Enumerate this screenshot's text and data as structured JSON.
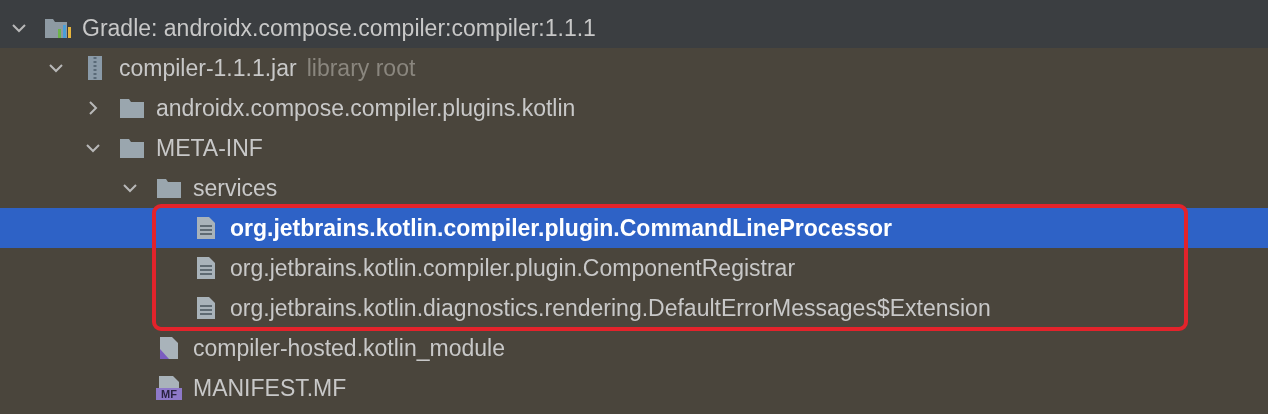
{
  "tree": [
    {
      "kind": "library",
      "label": "Gradle: androidx.compose.compiler:compiler:1.1.1",
      "expanded": true,
      "selected": false,
      "children": [
        {
          "kind": "jar",
          "label": "compiler-1.1.1.jar",
          "hint": "library root",
          "expanded": true,
          "selected": false,
          "children": [
            {
              "kind": "folder",
              "label": "androidx.compose.compiler.plugins.kotlin",
              "expanded": false,
              "selected": false
            },
            {
              "kind": "folder",
              "label": "META-INF",
              "expanded": true,
              "selected": false,
              "children": [
                {
                  "kind": "folder",
                  "label": "services",
                  "expanded": true,
                  "selected": false,
                  "children": [
                    {
                      "kind": "file",
                      "label": "org.jetbrains.kotlin.compiler.plugin.CommandLineProcessor",
                      "selected": true
                    },
                    {
                      "kind": "file",
                      "label": "org.jetbrains.kotlin.compiler.plugin.ComponentRegistrar",
                      "selected": false
                    },
                    {
                      "kind": "file",
                      "label": "org.jetbrains.kotlin.diagnostics.rendering.DefaultErrorMessages$Extension",
                      "selected": false
                    }
                  ]
                },
                {
                  "kind": "module",
                  "label": "compiler-hosted.kotlin_module",
                  "selected": false
                },
                {
                  "kind": "manifest",
                  "label": "MANIFEST.MF",
                  "icon_text": "MF",
                  "selected": false
                }
              ]
            }
          ]
        }
      ]
    }
  ]
}
